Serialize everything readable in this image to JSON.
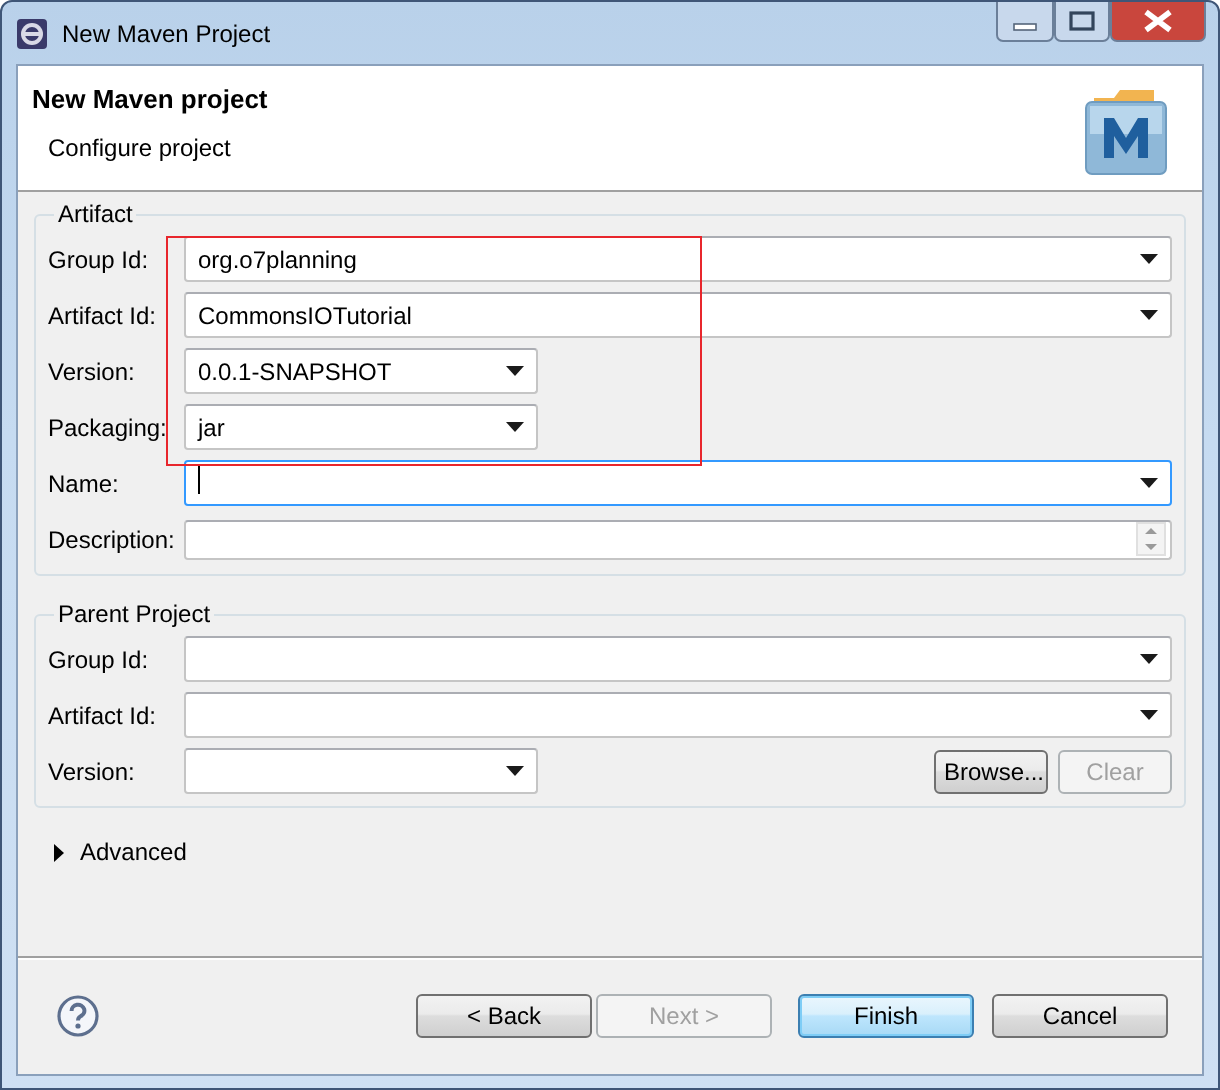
{
  "window": {
    "title": "New Maven Project"
  },
  "header": {
    "title": "New Maven project",
    "subtitle": "Configure project"
  },
  "artifact": {
    "title": "Artifact",
    "fields": [
      {
        "label": "Group Id:",
        "value": "org.o7planning",
        "kind": "combo-wide",
        "focused": false
      },
      {
        "label": "Artifact Id:",
        "value": "CommonsIOTutorial",
        "kind": "combo-wide",
        "focused": false
      },
      {
        "label": "Version:",
        "value": "0.0.1-SNAPSHOT",
        "kind": "combo-narrow",
        "focused": false
      },
      {
        "label": "Packaging:",
        "value": "jar",
        "kind": "combo-narrow",
        "focused": false
      },
      {
        "label": "Name:",
        "kind": "combo-wide",
        "focused": true
      },
      {
        "label": "Description:",
        "kind": "memo",
        "focused": false
      }
    ]
  },
  "parent_project": {
    "title": "Parent Project",
    "fields": [
      {
        "label": "Group Id:",
        "kind": "combo-wide",
        "focused": false
      },
      {
        "label": "Artifact Id:",
        "kind": "combo-wide",
        "focused": false
      },
      {
        "label": "Version:",
        "kind": "combo-narrow",
        "focused": false
      }
    ],
    "buttons": [
      {
        "label": "Browse...",
        "disabled": false
      },
      {
        "label": "Clear",
        "disabled": true
      }
    ]
  },
  "advanced": {
    "label": "Advanced",
    "expanded": false
  },
  "buttons": [
    {
      "label": "< Back",
      "disabled": false,
      "default": false
    },
    {
      "label": "Next >",
      "disabled": true,
      "default": false
    },
    {
      "label": "Finish",
      "disabled": false,
      "default": true
    },
    {
      "label": "Cancel",
      "disabled": false,
      "default": false
    }
  ]
}
